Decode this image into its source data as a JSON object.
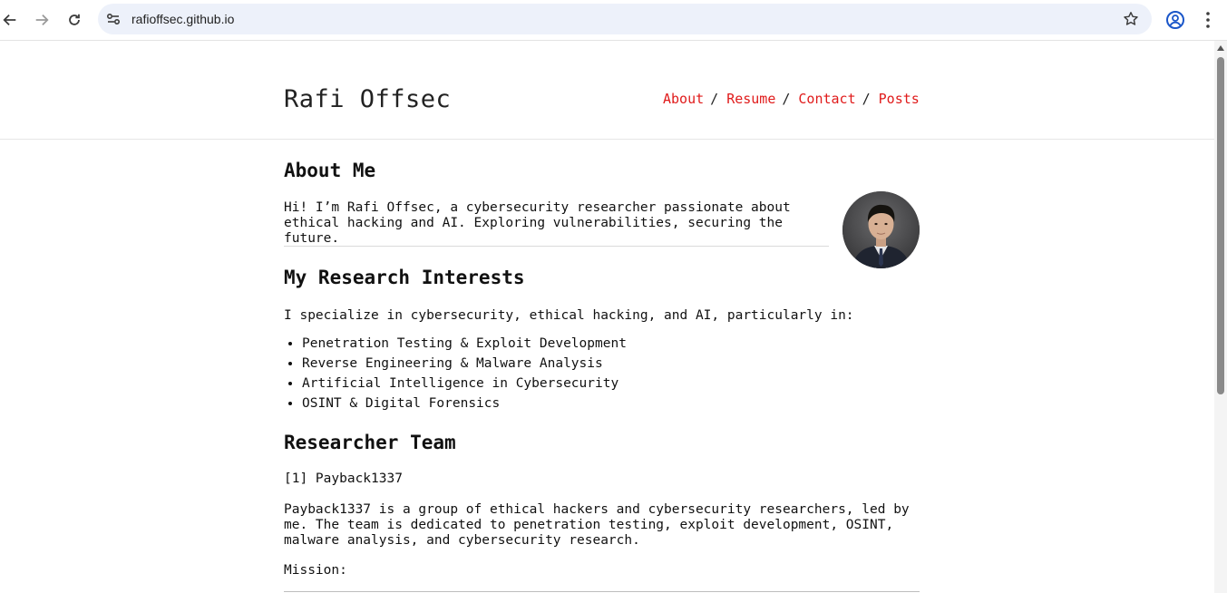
{
  "browser": {
    "url": "rafioffsec.github.io"
  },
  "site": {
    "title": "Rafi Offsec",
    "nav": [
      {
        "label": "About",
        "sep": "/"
      },
      {
        "label": "Resume",
        "sep": "/"
      },
      {
        "label": "Contact",
        "sep": "/"
      },
      {
        "label": "Posts"
      }
    ]
  },
  "about": {
    "heading": "About Me",
    "intro": "Hi! I’m Rafi Offsec, a cybersecurity researcher passionate about ethical hacking and AI. Exploring vulnerabilities, securing the future."
  },
  "research": {
    "heading": "My Research Interests",
    "intro": "I specialize in cybersecurity, ethical hacking, and AI, particularly in:",
    "items": [
      "Penetration Testing & Exploit Development",
      "Reverse Engineering & Malware Analysis",
      "Artificial Intelligence in Cybersecurity",
      "OSINT & Digital Forensics"
    ]
  },
  "team": {
    "heading": "Researcher Team",
    "entry": "[1] Payback1337",
    "description": "Payback1337 is a group of ethical hackers and cybersecurity researchers, led by me. The team is dedicated to penetration testing, exploit development, OSINT, malware analysis, and cybersecurity research.",
    "mission_label": "Mission:"
  },
  "colors": {
    "link": "#e01b1b",
    "omnibox_bg": "#edf1fa"
  },
  "icons": [
    "back-arrow-icon",
    "forward-arrow-icon",
    "reload-icon",
    "site-settings-icon",
    "bookmark-star-icon",
    "profile-icon",
    "kebab-menu-icon"
  ]
}
